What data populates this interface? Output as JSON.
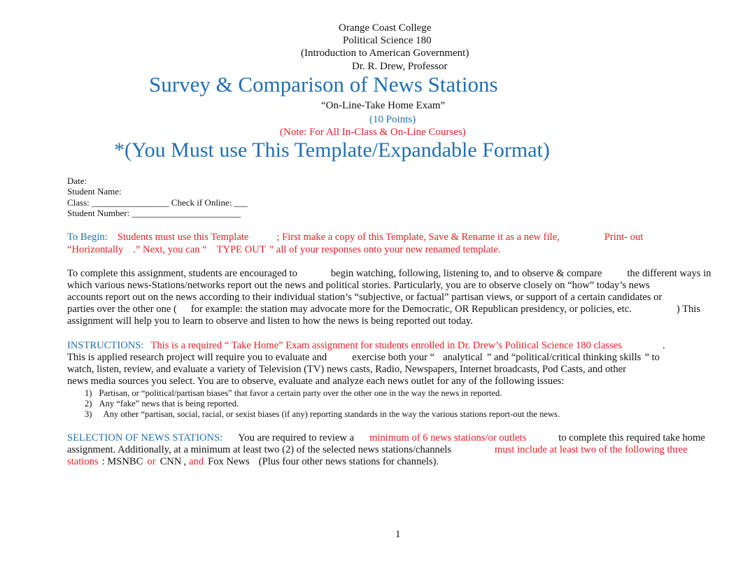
{
  "header": {
    "college": "Orange Coast College",
    "course": "Political Science 180",
    "course_subtitle": "(Introduction to American Government)",
    "professor": "Dr. R. Drew, Professor"
  },
  "title": "Survey & Comparison of News Stations",
  "exam_type": "“On-Line-Take Home Exam”",
  "points": "(10 Points)",
  "note": "(Note:  For All In-Class & On-Line Courses)",
  "template_notice": "*(You Must use This Template/Expandable Format)",
  "fields": {
    "date": "Date:",
    "student_name": "Student Name:",
    "class": "Class: _________________ Check if Online: ___",
    "student_number": "Student Number: ________________________"
  },
  "to_begin": {
    "label": "To Begin:",
    "line1_a": "Students must use this Template",
    "line1_b": ";  First  make a copy of this Template, Save & Rename it as a new file,",
    "line1_c": "Print- out",
    "line2_a": "“Horizontally",
    "line2_b": ".” Next, you can “",
    "line2_c": "TYPE OUT",
    "line2_d": "” all of your responses onto your new renamed template."
  },
  "intro": {
    "line1_a": "To complete this assignment, students are encouraged to",
    "line1_b": "begin watching, following, listening to, and to observe & compare",
    "line1_c": "the different ways in",
    "line2": "which various news-Stations/networks report out the news and political stories. Particularly, you are to observe closely on “how” today’s news",
    "line3": "accounts report out on the news according to their individual station’s “subjective, or factual” partisan views, or support of a certain candidates or",
    "line4_a": "parties over the other one (",
    "line4_b": "for example: the station may advocate more for the Democratic, OR Republican presidency, or policies, etc.",
    "line4_c": ") This",
    "line5": "assignment will help you to learn to observe and listen to how the news is being reported out today."
  },
  "instructions": {
    "label": "INSTRUCTIONS:",
    "line1_red": "This is a required “  Take Home” Exam assignment for students enrolled in Dr. Drew’s Political Science 180 classes",
    "line1_end": ".",
    "line2_a": "This  is applied research project will require you to evaluate and",
    "line2_b": "exercise both your “",
    "line2_c": "analytical",
    "line2_d": "” and “political/critical thinking skills",
    "line2_e": "” to",
    "line3": "watch, listen, review, and evaluate a variety of Television (TV) news casts, Radio, Newspapers, Internet broadcasts, Pod Casts, and other",
    "line4": "news media sources you select. You are to observe, evaluate and analyze each news outlet for any of the following issues:",
    "issues": [
      {
        "num": "1)",
        "text": "Partisan, or “political/partisan biases” that favor a certain party over the other one in the way the news in reported."
      },
      {
        "num": "2)",
        "text": "Any “fake” news that is being reported."
      },
      {
        "num": "3)",
        "text": "Any other “partisan, social, racial, or sexist biases (if any) reporting standards in the way the various stations report-out the news."
      }
    ]
  },
  "selection": {
    "label": "SELECTION OF NEWS STATIONS:",
    "line1_a": "You are required to review a",
    "line1_red": "minimum of 6 news stations/or outlets",
    "line1_b": "to complete this required take home",
    "line2_a": "assignment. Additionally, at a minimum at least two (2) of the selected news stations/channels",
    "line2_red": "must include at least two of the following three",
    "line3_red_a": "stations",
    "line3_b": ": MSNBC",
    "line3_red_or": "or",
    "line3_c": "CNN",
    "line3_d": ",",
    "line3_red_and": "and",
    "line3_e": "Fox News",
    "line3_f": "(Plus four other news stations for channels)."
  },
  "page_number": "1"
}
